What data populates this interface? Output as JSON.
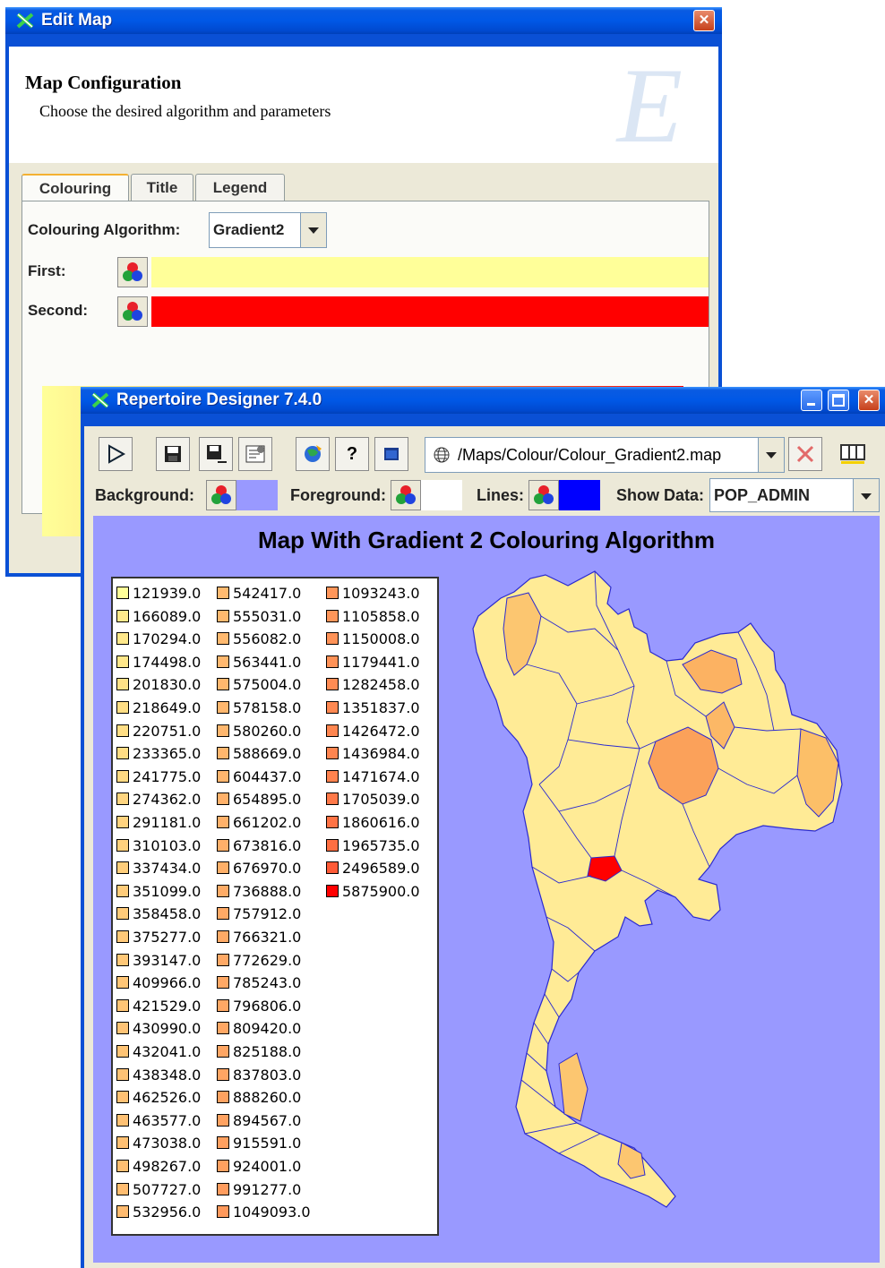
{
  "edit_map": {
    "title": "Edit Map",
    "close_label": "✕",
    "header_title": "Map Configuration",
    "header_subtitle": "Choose the desired algorithm and parameters",
    "watermark": "E",
    "tabs": [
      {
        "label": "Colouring",
        "active": true
      },
      {
        "label": "Title",
        "active": false
      },
      {
        "label": "Legend",
        "active": false
      }
    ],
    "algorithm_label": "Colouring Algorithm:",
    "algorithm_value": "Gradient2",
    "first_label": "First:",
    "first_color": "#ffff99",
    "second_label": "Second:",
    "second_color": "#ff0000"
  },
  "designer": {
    "title": "Repertoire Designer 7.4.0",
    "path": "/Maps/Colour/Colour_Gradient2.map",
    "toolbar_icons": [
      "play-icon",
      "save-icon",
      "save-as-icon",
      "properties-icon",
      "globe-icon",
      "help-icon",
      "window-icon"
    ],
    "help_glyph": "?",
    "background_label": "Background:",
    "background_color": "#9999ff",
    "foreground_label": "Foreground:",
    "foreground_color": "#ffffff",
    "lines_label": "Lines:",
    "lines_color": "#0000ff",
    "show_data_label": "Show Data:",
    "show_data_value": "POP_ADMIN",
    "map_title": "Map With Gradient 2 Colouring Algorithm"
  },
  "legend": {
    "columns": [
      [
        "121939.0",
        "166089.0",
        "170294.0",
        "174498.0",
        "201830.0",
        "218649.0",
        "220751.0",
        "233365.0",
        "241775.0",
        "274362.0",
        "291181.0",
        "310103.0",
        "337434.0",
        "351099.0",
        "358458.0",
        "375277.0",
        "393147.0",
        "409966.0",
        "421529.0",
        "430990.0",
        "432041.0",
        "438348.0",
        "462526.0",
        "463577.0",
        "473038.0",
        "498267.0",
        "507727.0",
        "532956.0"
      ],
      [
        "542417.0",
        "555031.0",
        "556082.0",
        "563441.0",
        "575004.0",
        "578158.0",
        "580260.0",
        "588669.0",
        "604437.0",
        "654895.0",
        "661202.0",
        "673816.0",
        "676970.0",
        "736888.0",
        "757912.0",
        "766321.0",
        "772629.0",
        "785243.0",
        "796806.0",
        "809420.0",
        "825188.0",
        "837803.0",
        "888260.0",
        "894567.0",
        "915591.0",
        "924001.0",
        "991277.0",
        "1049093.0"
      ],
      [
        "1093243.0",
        "1105858.0",
        "1150008.0",
        "1179441.0",
        "1282458.0",
        "1351837.0",
        "1426472.0",
        "1436984.0",
        "1471674.0",
        "1705039.0",
        "1860616.0",
        "1965735.0",
        "2496589.0",
        "5875900.0"
      ]
    ],
    "min_value": 121939.0,
    "max_value": 5875900.0,
    "gradient_start": "#ffff99",
    "gradient_end": "#ff0000"
  }
}
